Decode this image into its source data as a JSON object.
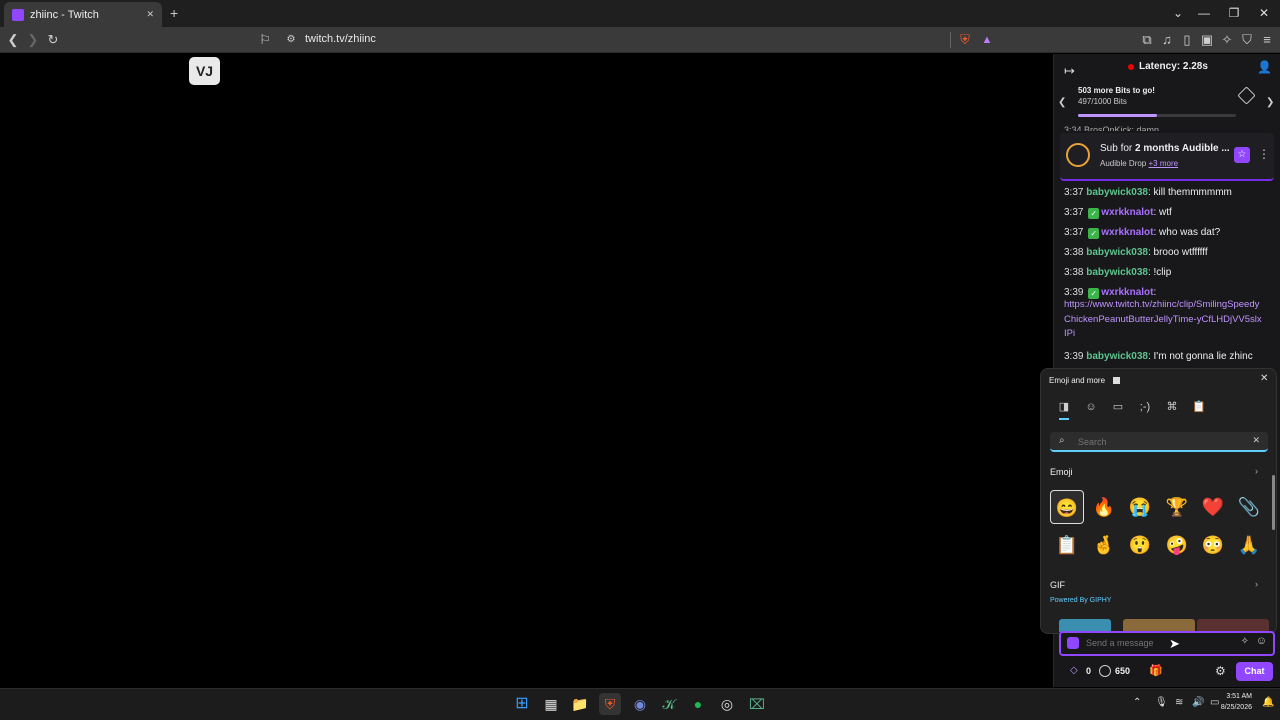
{
  "browser": {
    "tab_title": "zhiinc - Twitch",
    "url": "twitch.tv/zhiinc",
    "new_tab": "+",
    "close_tab": "✕"
  },
  "video": {
    "logo_text": "VJ"
  },
  "chat": {
    "latency": "Latency: 2.28s",
    "bits_title": "503 more Bits to go!",
    "bits_progress_text": "497/1000 Bits",
    "bits_progress_fraction": 0.497,
    "partial_top_message": "3:34 BrosOnKick: damn",
    "drop": {
      "title_prefix": "Sub for ",
      "title_bold": "2 months Audible ...",
      "sub_prefix": "Audible Drop ",
      "sub_link": "+3 more"
    },
    "messages": [
      {
        "time": "3:37",
        "user": "babywick038",
        "color": "green",
        "badge": false,
        "text": ": kill themmmmmm"
      },
      {
        "time": "3:37",
        "user": "wxrkknalot",
        "color": "purple",
        "badge": true,
        "text": ": wtf"
      },
      {
        "time": "3:37",
        "user": "wxrkknalot",
        "color": "purple",
        "badge": true,
        "text": ": who was dat?"
      },
      {
        "time": "3:38",
        "user": "babywick038",
        "color": "green",
        "badge": false,
        "text": ": brooo wtffffff"
      },
      {
        "time": "3:38",
        "user": "babywick038",
        "color": "green",
        "badge": false,
        "text": ": !clip"
      },
      {
        "time": "3:39",
        "user": "wxrkknalot",
        "color": "purple",
        "badge": true,
        "text": ":"
      },
      {
        "time": "3:39",
        "user": "babywick038",
        "color": "green",
        "badge": false,
        "text": ": I'm not gonna lie zhinc"
      }
    ],
    "clip_link": "https://www.twitch.tv/zhiinc/clip/SmilingSpeedyChickenPeanutButterJellyTime-yCfLHDjVV5slxIPi",
    "input_placeholder": "Send a message",
    "bits_count": "0",
    "points_count": "650",
    "chat_button": "Chat"
  },
  "emoji_panel": {
    "title": "Emoji and more",
    "search_placeholder": "Search",
    "emoji_heading": "Emoji",
    "gif_heading": "GIF",
    "powered_by": "Powered By GIPHY",
    "emojis_row1": [
      "😄",
      "🔥",
      "😭",
      "🏆",
      "❤️",
      "📎"
    ],
    "emojis_row2": [
      "📋",
      "🤞",
      "😲",
      "🤪",
      "😳",
      "🙏"
    ]
  },
  "taskbar": {
    "time": "3:51 AM",
    "date": "8/25/2026"
  },
  "colors": {
    "twitch_purple": "#9146ff",
    "chat_bg": "#18181b"
  }
}
